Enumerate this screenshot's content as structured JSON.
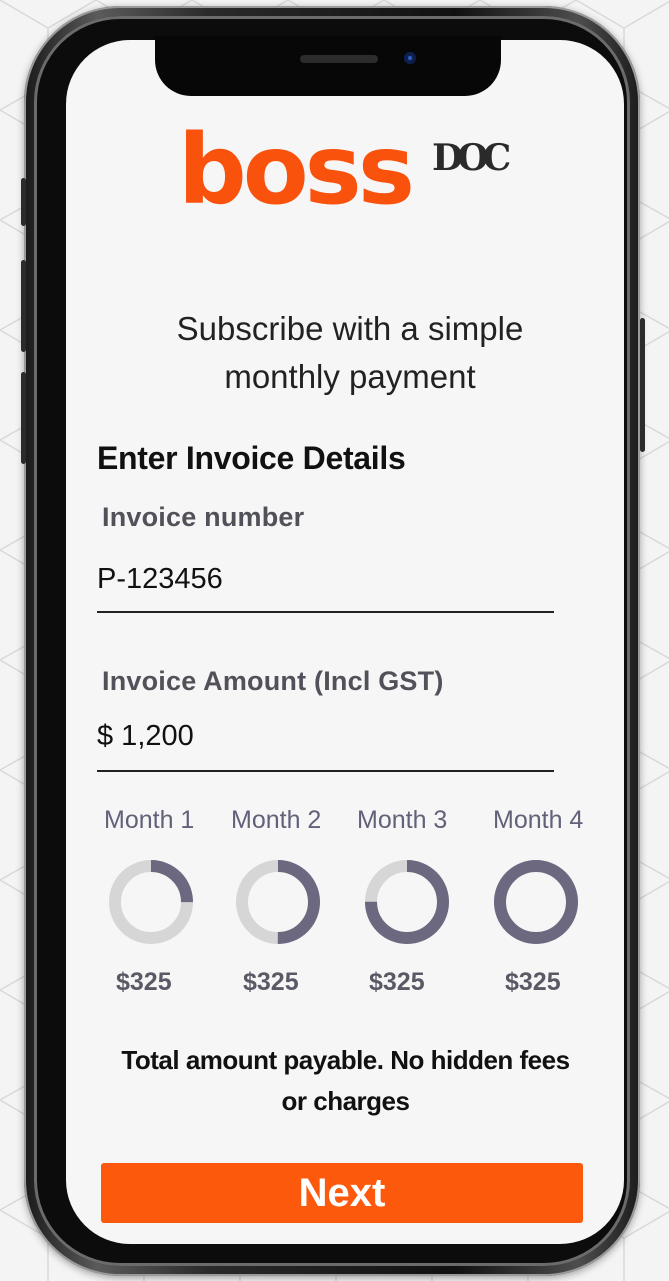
{
  "brand": {
    "name": "boss",
    "mark": "DOC",
    "accent_color": "#f9520c"
  },
  "tagline": {
    "line1": "Subscribe with a simple",
    "line2": "monthly payment"
  },
  "form": {
    "heading": "Enter Invoice Details",
    "invoice_number": {
      "label": "Invoice number",
      "value": "P-123456"
    },
    "invoice_amount": {
      "label": "Invoice Amount (Incl GST)",
      "value": "$ 1,200"
    }
  },
  "schedule": [
    {
      "label": "Month 1",
      "amount": "$325",
      "progress": 0.25
    },
    {
      "label": "Month 2",
      "amount": "$325",
      "progress": 0.5
    },
    {
      "label": "Month 3",
      "amount": "$325",
      "progress": 0.75
    },
    {
      "label": "Month 4",
      "amount": "$325",
      "progress": 1.0
    }
  ],
  "ring_colors": {
    "track": "#d6d6d6",
    "fill": "#6b6880"
  },
  "note": {
    "line1": "Total amount payable. No hidden fees",
    "line2": "or charges"
  },
  "next_button": {
    "label": "Next",
    "color": "#fd590d"
  }
}
